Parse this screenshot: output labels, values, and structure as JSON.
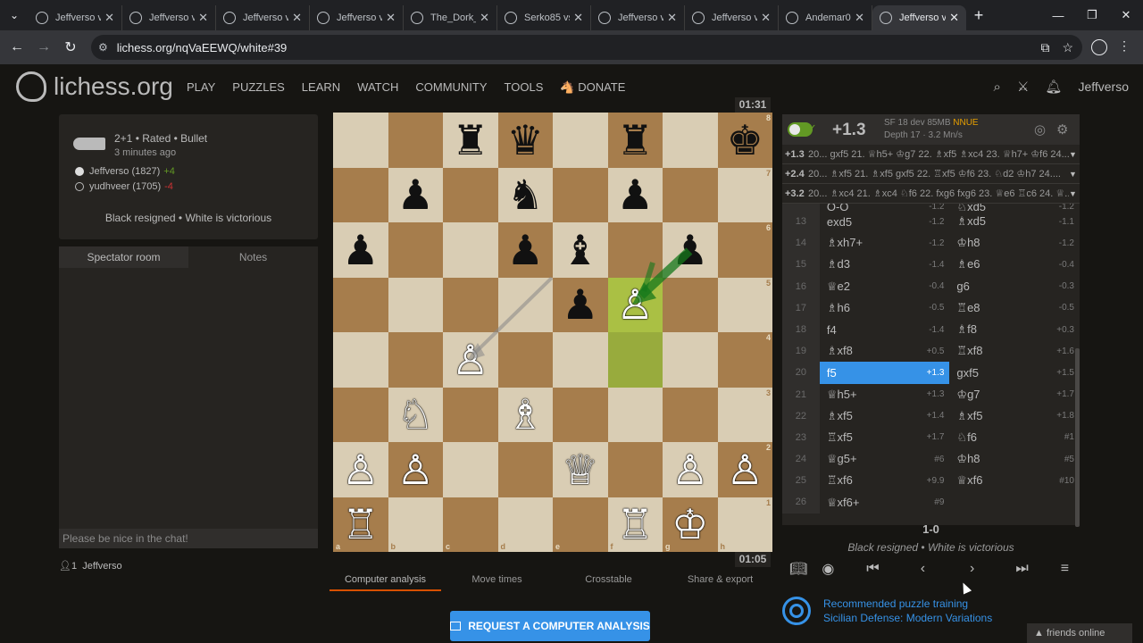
{
  "browser": {
    "tabs": [
      {
        "label": "Jeffverso v",
        "active": false
      },
      {
        "label": "Jeffverso v",
        "active": false
      },
      {
        "label": "Jeffverso v",
        "active": false
      },
      {
        "label": "Jeffverso v",
        "active": false
      },
      {
        "label": "The_Dork_",
        "active": false
      },
      {
        "label": "Serko85 vs",
        "active": false
      },
      {
        "label": "Jeffverso v",
        "active": false
      },
      {
        "label": "Jeffverso v",
        "active": false
      },
      {
        "label": "Andemar0",
        "active": false
      },
      {
        "label": "Jeffverso v",
        "active": true
      }
    ],
    "url": "lichess.org/nqVaEEWQ/white#39"
  },
  "site": {
    "logo": "lichess.org",
    "nav": [
      "PLAY",
      "PUZZLES",
      "LEARN",
      "WATCH",
      "COMMUNITY",
      "TOOLS"
    ],
    "donate": "DONATE",
    "username": "Jeffverso"
  },
  "game": {
    "type": "2+1 • Rated • Bullet",
    "time": "3 minutes ago",
    "white": {
      "name": "Jeffverso (1827)",
      "diff": "+4"
    },
    "black": {
      "name": "yudhveer (1705)",
      "diff": "-4"
    },
    "result_text": "Black resigned • White is victorious"
  },
  "chat": {
    "tabs": [
      "Spectator room",
      "Notes"
    ],
    "placeholder": "Please be nice in the chat!",
    "spectators_count": "1",
    "spectator": "Jeffverso"
  },
  "clocks": {
    "top": "01:31",
    "bottom": "01:05"
  },
  "board": {
    "position": [
      [
        "",
        "",
        "♜",
        "♛",
        "",
        "♜",
        "",
        "♚"
      ],
      [
        "",
        "♟",
        "",
        "♞",
        "",
        "♟",
        "",
        ""
      ],
      [
        "♟",
        "",
        "",
        "♟",
        "♝",
        "",
        "♟",
        ""
      ],
      [
        "",
        "",
        "",
        "",
        "♟",
        "♙",
        "",
        ""
      ],
      [
        "",
        "",
        "♙",
        "",
        "",
        "",
        "",
        ""
      ],
      [
        "",
        "♘",
        "",
        "♗",
        "",
        "",
        "",
        ""
      ],
      [
        "♙",
        "♙",
        "",
        "",
        "♕",
        "",
        "♙",
        "♙"
      ],
      [
        "♖",
        "",
        "",
        "",
        "",
        "♖",
        "♔",
        ""
      ]
    ],
    "ranks": [
      "8",
      "7",
      "6",
      "5",
      "4",
      "3",
      "2",
      "1"
    ],
    "files": [
      "a",
      "b",
      "c",
      "d",
      "e",
      "f",
      "g",
      "h"
    ]
  },
  "board_tabs": [
    "Computer analysis",
    "Move times",
    "Crosstable",
    "Share & export"
  ],
  "request_button": "REQUEST A COMPUTER ANALYSIS",
  "ceval": {
    "score": "+1.3",
    "engine": "SF 18 dev 85MB",
    "nnue": "NNUE",
    "depth": "Depth 17 · 3.2 Mn/s"
  },
  "pvs": [
    {
      "score": "+1.3",
      "line": "20... gxf5 21. ♕h5+ ♔g7 22. ♗xf5 ♗xc4 23. ♕h7+ ♔f6 24...."
    },
    {
      "score": "+2.4",
      "line": "20... ♗xf5 21. ♗xf5 gxf5 22. ♖xf5 ♔f6 23. ♘d2 ♔h7 24...."
    },
    {
      "score": "+3.2",
      "line": "20... ♗xc4 21. ♗xc4 ♘f6 22. fxg6 fxg6 23. ♕e6 ♖c6 24. ♕..."
    }
  ],
  "moves": [
    {
      "n": "13",
      "w": "exd5",
      "we": "-1.2",
      "b": "♗xd5",
      "be": "-1.1"
    },
    {
      "n": "14",
      "w": "♗xh7+",
      "we": "-1.2",
      "b": "♔h8",
      "be": "-1.2"
    },
    {
      "n": "15",
      "w": "♗d3",
      "we": "-1.4",
      "b": "♗e6",
      "be": "-0.4"
    },
    {
      "n": "16",
      "w": "♕e2",
      "we": "-0.4",
      "b": "g6",
      "be": "-0.3"
    },
    {
      "n": "17",
      "w": "♗h6",
      "we": "-0.5",
      "b": "♖e8",
      "be": "-0.5"
    },
    {
      "n": "18",
      "w": "f4",
      "we": "-1.4",
      "b": "♗f8",
      "be": "+0.3"
    },
    {
      "n": "19",
      "w": "♗xf8",
      "we": "+0.5",
      "b": "♖xf8",
      "be": "+1.6"
    },
    {
      "n": "20",
      "w": "f5",
      "we": "+1.3",
      "b": "gxf5",
      "be": "+1.5"
    },
    {
      "n": "21",
      "w": "♕h5+",
      "we": "+1.3",
      "b": "♔g7",
      "be": "+1.7"
    },
    {
      "n": "22",
      "w": "♗xf5",
      "we": "+1.4",
      "b": "♗xf5",
      "be": "+1.8"
    },
    {
      "n": "23",
      "w": "♖xf5",
      "we": "+1.7",
      "b": "♘f6",
      "be": "#1"
    },
    {
      "n": "24",
      "w": "♕g5+",
      "we": "#6",
      "b": "♔h8",
      "be": "#5"
    },
    {
      "n": "25",
      "w": "♖xf6",
      "we": "+9.9",
      "b": "♕xf6",
      "be": "#10"
    },
    {
      "n": "26",
      "w": "♕xf6+",
      "we": "#9",
      "b": "",
      "be": ""
    }
  ],
  "moves_partial_top": {
    "w": "O-O",
    "we": "-1.2",
    "b": "♘xd5",
    "be": "-1.2"
  },
  "final_result": "1-0",
  "final_desc": "Black resigned • White is victorious",
  "puzzle": {
    "line1": "Recommended puzzle training",
    "line2": "Sicilian Defense: Modern Variations"
  },
  "friends": "friends online"
}
